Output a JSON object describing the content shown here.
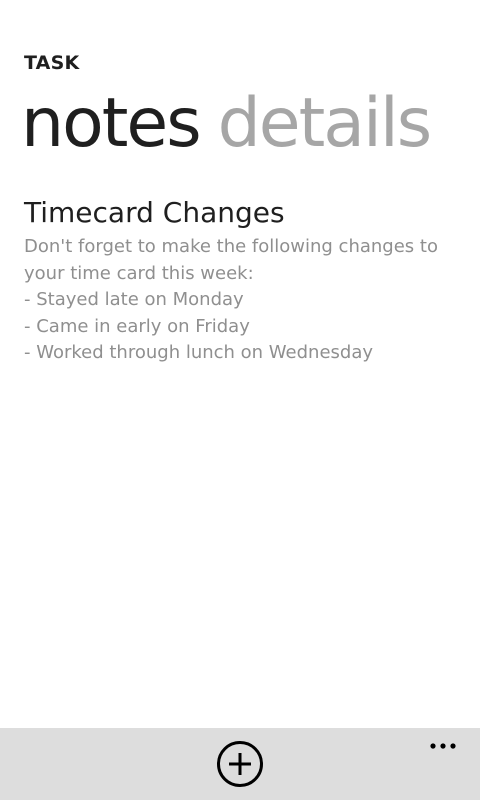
{
  "app": {
    "title": "TASK"
  },
  "pivot": {
    "items": [
      {
        "label": "notes",
        "active": true
      },
      {
        "label": "details",
        "active": false
      }
    ]
  },
  "note": {
    "title": "Timecard Changes",
    "lines": [
      "Don't forget to make the following changes to",
      "your time card this week:",
      "- Stayed late on Monday",
      "- Came in early on Friday",
      "- Worked through lunch on Wednesday"
    ]
  },
  "app_bar": {
    "buttons": [
      {
        "icon": "add-icon"
      },
      {
        "icon": "more-icon"
      }
    ],
    "background": "#dddddd"
  },
  "colors": {
    "text_primary": "#1f1f1f",
    "text_secondary": "#8f8f8f",
    "pivot_inactive": "#a6a6a6",
    "background": "#ffffff"
  }
}
